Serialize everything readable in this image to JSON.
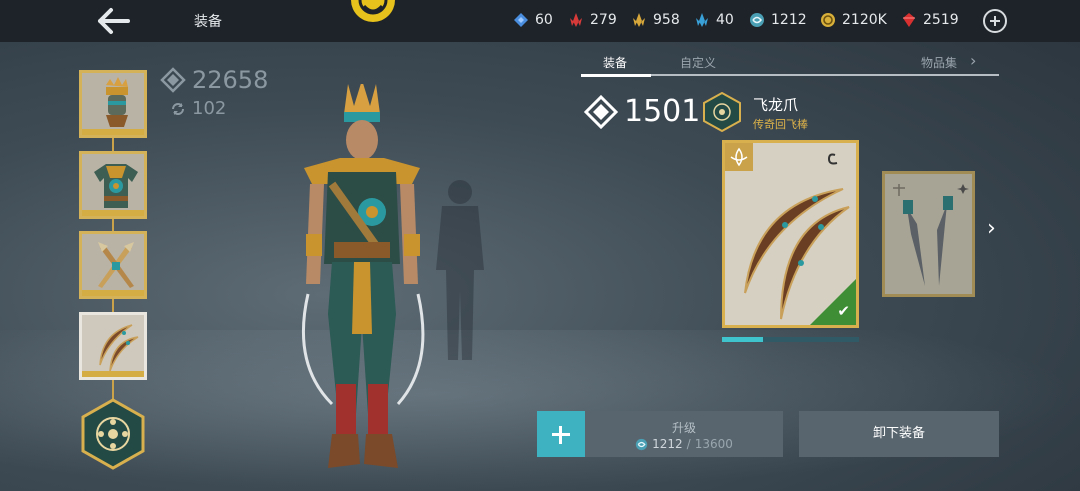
{
  "header": {
    "title": "装备",
    "currencies": [
      {
        "icon": "blue-diamond-icon",
        "color": "#4a8ee0",
        "value": "60"
      },
      {
        "icon": "red-crystal-icon",
        "color": "#d83a3a",
        "value": "279"
      },
      {
        "icon": "gold-crystal-icon",
        "color": "#d8a83a",
        "value": "958"
      },
      {
        "icon": "blue-crystal-icon",
        "color": "#3aa0d8",
        "value": "40"
      },
      {
        "icon": "spirit-orb-icon",
        "color": "#6cc3d8",
        "value": "1212"
      },
      {
        "icon": "coin-icon",
        "color": "#d8b03a",
        "value": "2120K"
      },
      {
        "icon": "ruby-icon",
        "color": "#d83030",
        "value": "2519"
      }
    ]
  },
  "character": {
    "power": "22658",
    "sub_stat": "102"
  },
  "tabs": [
    {
      "label": "装备",
      "active": true
    },
    {
      "label": "自定义",
      "active": false
    },
    {
      "label": "物品集",
      "active": false
    }
  ],
  "weapon": {
    "power": "1501",
    "name": "飞龙爪",
    "type": "传奇回飞棒",
    "progress": 0.3
  },
  "actions": {
    "upgrade_label": "升级",
    "upgrade_current": "1212",
    "upgrade_separator": "/",
    "upgrade_total": "13600",
    "unequip_label": "卸下装备"
  },
  "colors": {
    "accent_gold": "#d8b04e",
    "accent_teal": "#3fb2c2",
    "legendary_text": "#e0b54a",
    "equipped_green": "#3f8e35"
  }
}
